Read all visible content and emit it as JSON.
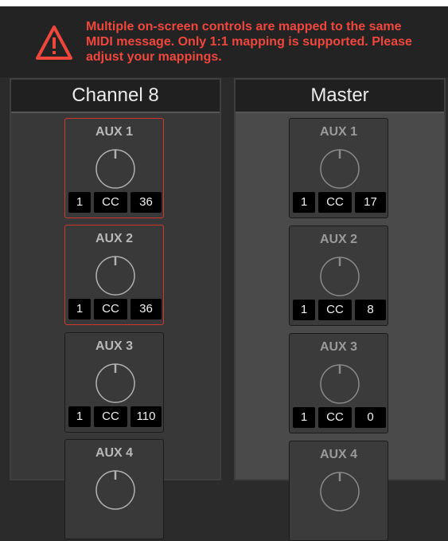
{
  "warning": {
    "message_lines": [
      "Multiple on-screen controls are mapped to the same",
      "MIDI message. Only 1:1 mapping is supported. Please",
      "adjust your mappings."
    ],
    "color": "#f0473d"
  },
  "columns": [
    {
      "title": "Channel 8",
      "controls": [
        {
          "label": "AUX 1",
          "channel": "1",
          "type": "CC",
          "number": "36",
          "conflict": true
        },
        {
          "label": "AUX 2",
          "channel": "1",
          "type": "CC",
          "number": "36",
          "conflict": true
        },
        {
          "label": "AUX 3",
          "channel": "1",
          "type": "CC",
          "number": "110",
          "conflict": false
        },
        {
          "label": "AUX 4"
        }
      ]
    },
    {
      "title": "Master",
      "controls": [
        {
          "label": "AUX 1",
          "channel": "1",
          "type": "CC",
          "number": "17",
          "conflict": false
        },
        {
          "label": "AUX 2",
          "channel": "1",
          "type": "CC",
          "number": "8",
          "conflict": false
        },
        {
          "label": "AUX 3",
          "channel": "1",
          "type": "CC",
          "number": "0",
          "conflict": false
        },
        {
          "label": "AUX 4"
        }
      ]
    }
  ],
  "colors": {
    "conflict_border": "#d2372e",
    "field_bg": "#000000"
  },
  "icons": {
    "warning": "warning-triangle-icon",
    "knob": "knob-icon"
  }
}
